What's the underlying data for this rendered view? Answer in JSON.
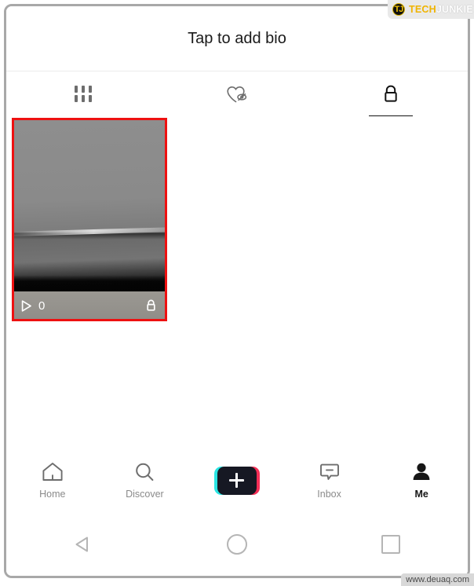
{
  "watermarks": {
    "brand_icon": "tech-junkie-circle-icon",
    "brand_part1": "TECH",
    "brand_part2": "JUNKIE",
    "site": "www.deuaq.com"
  },
  "header": {
    "bio_prompt": "Tap to add bio"
  },
  "tabs": [
    {
      "id": "posts",
      "icon": "grid-bars-icon",
      "active": false
    },
    {
      "id": "liked",
      "icon": "heart-hidden-icon",
      "active": false
    },
    {
      "id": "private",
      "icon": "lock-icon",
      "active": true
    }
  ],
  "videos": [
    {
      "play_count": "0",
      "play_icon": "play-triangle-icon",
      "privacy_icon": "lock-icon",
      "selected": true,
      "border_color": "#ee1111"
    }
  ],
  "app_nav": [
    {
      "id": "home",
      "label": "Home",
      "icon": "home-icon",
      "active": false
    },
    {
      "id": "discover",
      "label": "Discover",
      "icon": "search-icon",
      "active": false
    },
    {
      "id": "create",
      "label": "",
      "icon": "plus-icon",
      "active": false
    },
    {
      "id": "inbox",
      "label": "Inbox",
      "icon": "message-bubble-icon",
      "active": false
    },
    {
      "id": "me",
      "label": "Me",
      "icon": "person-icon",
      "active": true
    }
  ],
  "system_nav": [
    {
      "id": "back",
      "icon": "back-triangle-icon"
    },
    {
      "id": "home",
      "icon": "home-circle-icon"
    },
    {
      "id": "recents",
      "icon": "recents-square-icon"
    }
  ],
  "colors": {
    "accent_cyan": "#2ae5e3",
    "accent_pink": "#f52e56",
    "active_tab": "#121212",
    "selection": "#ee1111",
    "brand_yellow": "#f0b400"
  }
}
